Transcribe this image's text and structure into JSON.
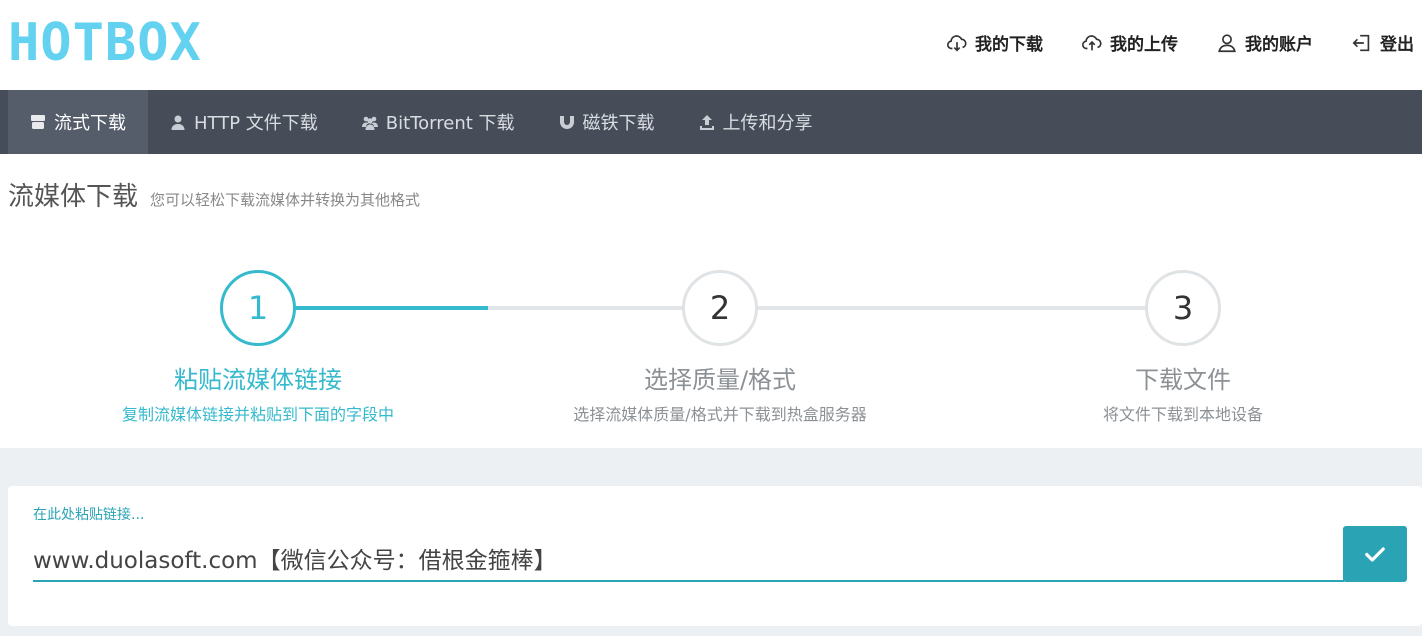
{
  "header": {
    "logo": "HOTBOX",
    "nav": [
      {
        "label": "我的下载",
        "icon": "cloud-download-icon"
      },
      {
        "label": "我的上传",
        "icon": "cloud-upload-icon"
      },
      {
        "label": "我的账户",
        "icon": "user-icon"
      },
      {
        "label": "登出",
        "icon": "logout-icon"
      }
    ]
  },
  "tabs": [
    {
      "label": "流式下载",
      "icon": "youtube-icon",
      "active": true
    },
    {
      "label": "HTTP 文件下载",
      "icon": "user-icon",
      "active": false
    },
    {
      "label": "BitTorrent 下载",
      "icon": "users-icon",
      "active": false
    },
    {
      "label": "磁铁下载",
      "icon": "magnet-icon",
      "active": false
    },
    {
      "label": "上传和分享",
      "icon": "upload-icon",
      "active": false
    }
  ],
  "page": {
    "title": "流媒体下载",
    "subtitle": "您可以轻松下载流媒体并转换为其他格式"
  },
  "steps": [
    {
      "number": "1",
      "label": "粘贴流媒体链接",
      "desc": "复制流媒体链接并粘贴到下面的字段中",
      "active": true
    },
    {
      "number": "2",
      "label": "选择质量/格式",
      "desc": "选择流媒体质量/格式并下载到热盒服务器",
      "active": false
    },
    {
      "number": "3",
      "label": "下载文件",
      "desc": "将文件下载到本地设备",
      "active": false
    }
  ],
  "form": {
    "field_label": "在此处粘贴链接...",
    "url_value": "www.duolasoft.com【微信公众号：借根金箍棒】",
    "submit_icon": "check-icon"
  },
  "colors": {
    "accent": "#2aa3b4",
    "logo": "#62d2f0",
    "tabbar": "#464d59"
  }
}
